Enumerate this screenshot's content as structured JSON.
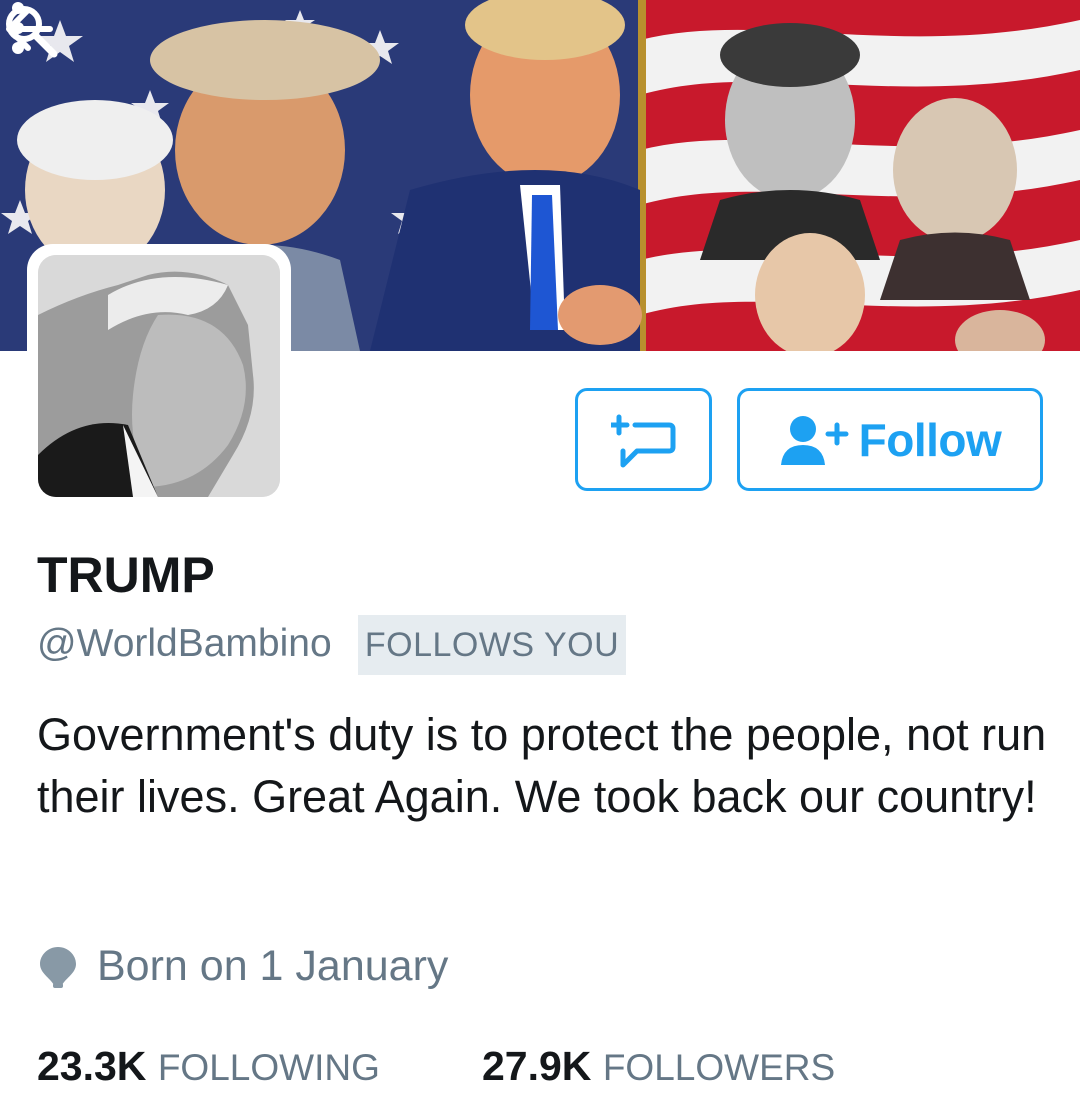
{
  "profile": {
    "display_name": "TRUMP",
    "handle": "@WorldBambino",
    "follows_you_badge": "FOLLOWS YOU",
    "bio": "Government's duty is to protect the people, not run their lives. Great Again. We took back our country!",
    "birthday": "Born on 1 January"
  },
  "actions": {
    "follow_label": "Follow"
  },
  "stats": {
    "following_count": "23.3K",
    "following_label": "FOLLOWING",
    "followers_count": "27.9K",
    "followers_label": "FOLLOWERS"
  },
  "colors": {
    "accent": "#1da1f2",
    "secondary_text": "#657786",
    "primary_text": "#14171a",
    "badge_bg": "#e6ecf0"
  },
  "icons": [
    "back-arrow-icon",
    "search-icon",
    "more-vertical-icon",
    "direct-message-icon",
    "add-user-icon",
    "location-pin-icon"
  ]
}
